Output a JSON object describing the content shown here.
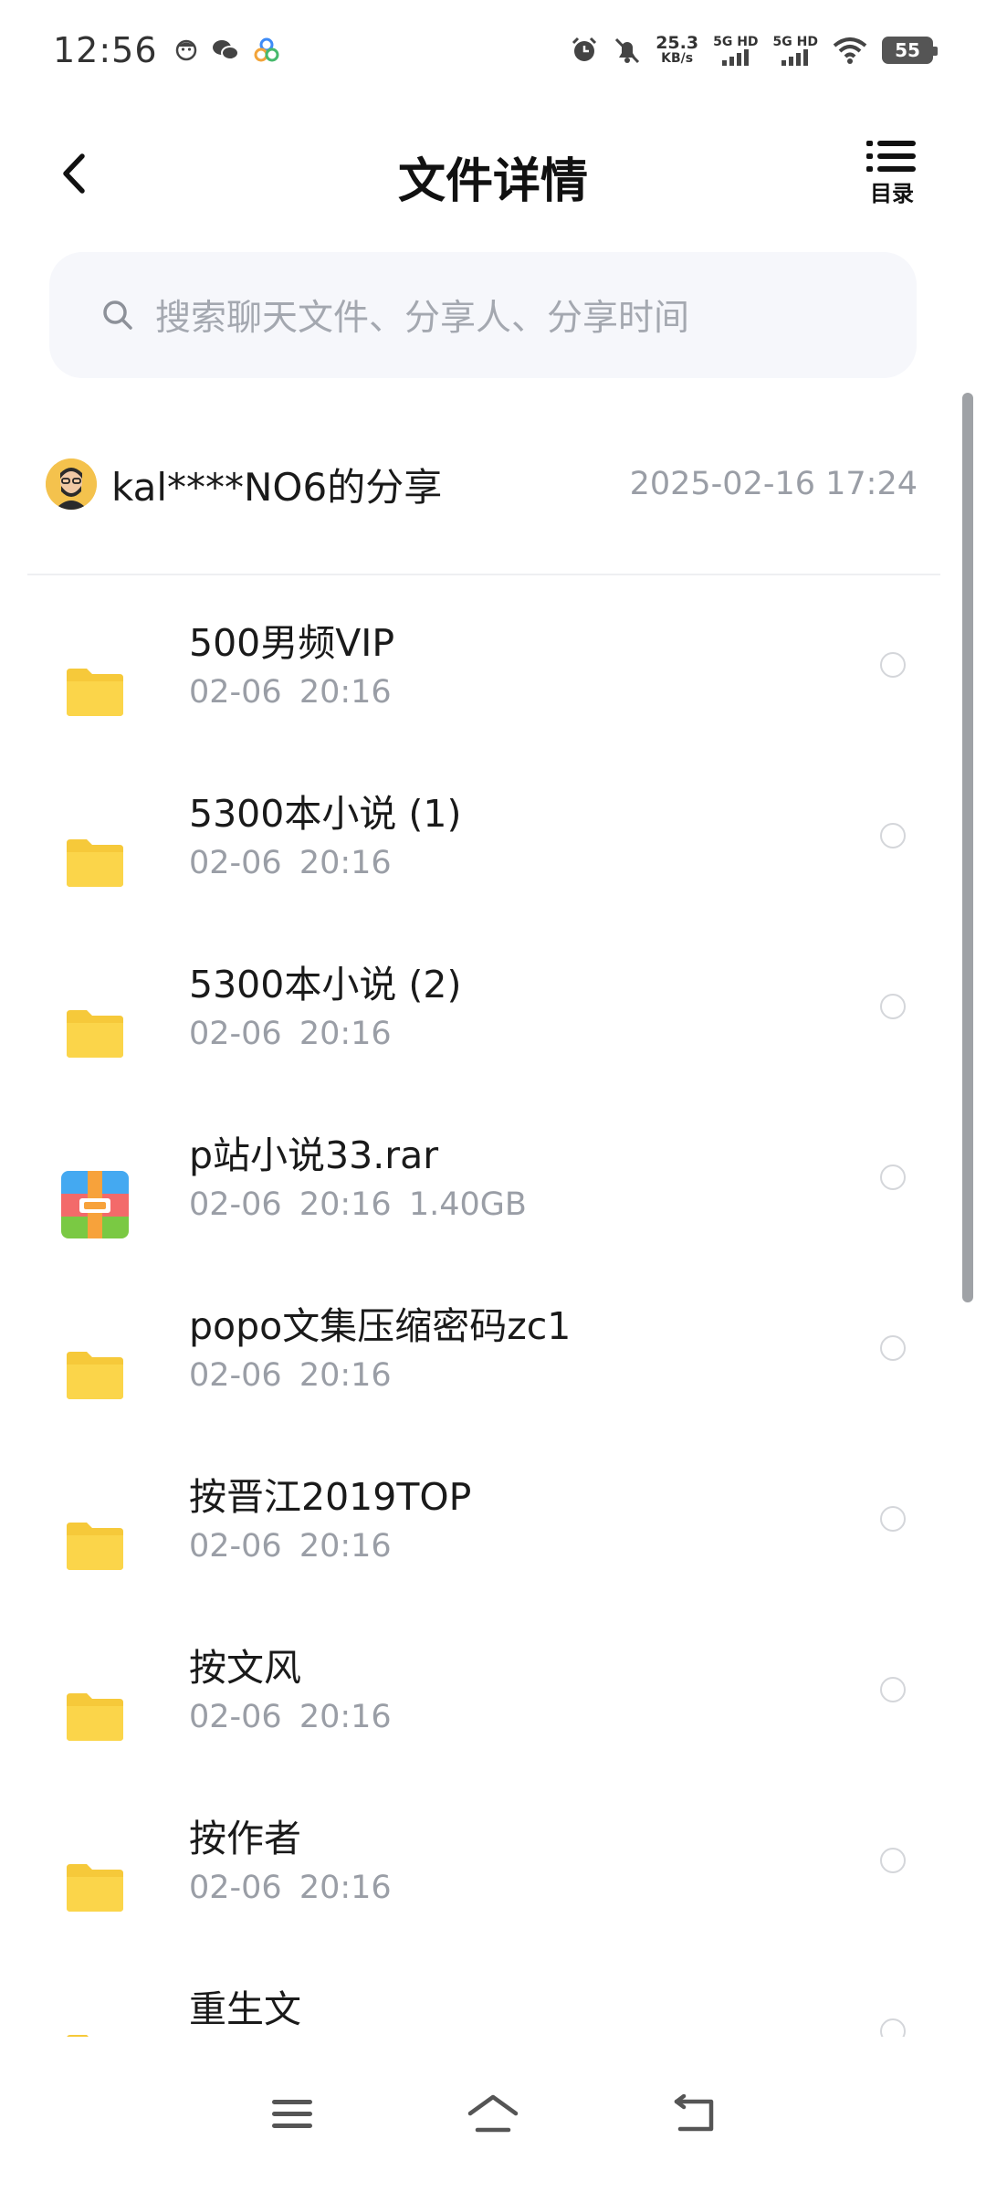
{
  "status_bar": {
    "time": "12:56",
    "network_speed_value": "25.3",
    "network_speed_unit": "KB/s",
    "sim1": "5G HD",
    "sim2": "5G HD",
    "battery": "55"
  },
  "header": {
    "title": "文件详情",
    "toc_label": "目录"
  },
  "search": {
    "placeholder": "搜索聊天文件、分享人、分享时间"
  },
  "share": {
    "sharer": "kal****NO6的分享",
    "time": "2025-02-16  17:24"
  },
  "files": [
    {
      "name": "500男频VIP",
      "meta": "02-06  20:16",
      "type": "folder"
    },
    {
      "name": "5300本小说 (1)",
      "meta": "02-06  20:16",
      "type": "folder"
    },
    {
      "name": "5300本小说 (2)",
      "meta": "02-06  20:16",
      "type": "folder"
    },
    {
      "name": "p站小说33.rar",
      "meta": "02-06  20:16  1.40GB",
      "type": "archive"
    },
    {
      "name": "popo文集压缩密码zc1",
      "meta": "02-06  20:16",
      "type": "folder"
    },
    {
      "name": "按晋江2019TOP",
      "meta": "02-06  20:16",
      "type": "folder"
    },
    {
      "name": "按文风",
      "meta": "02-06  20:16",
      "type": "folder"
    },
    {
      "name": "按作者",
      "meta": "02-06  20:16",
      "type": "folder"
    },
    {
      "name": "重生文",
      "meta": "",
      "type": "folder"
    }
  ],
  "colors": {
    "folder": "#fbd54a",
    "folder_tab": "#f6c93a",
    "text_secondary": "#9a9ea6"
  },
  "icons": {
    "back": "chevron-left-icon",
    "toc": "list-icon",
    "search": "search-icon",
    "menu": "menu-icon",
    "home": "home-icon",
    "return": "return-icon"
  }
}
